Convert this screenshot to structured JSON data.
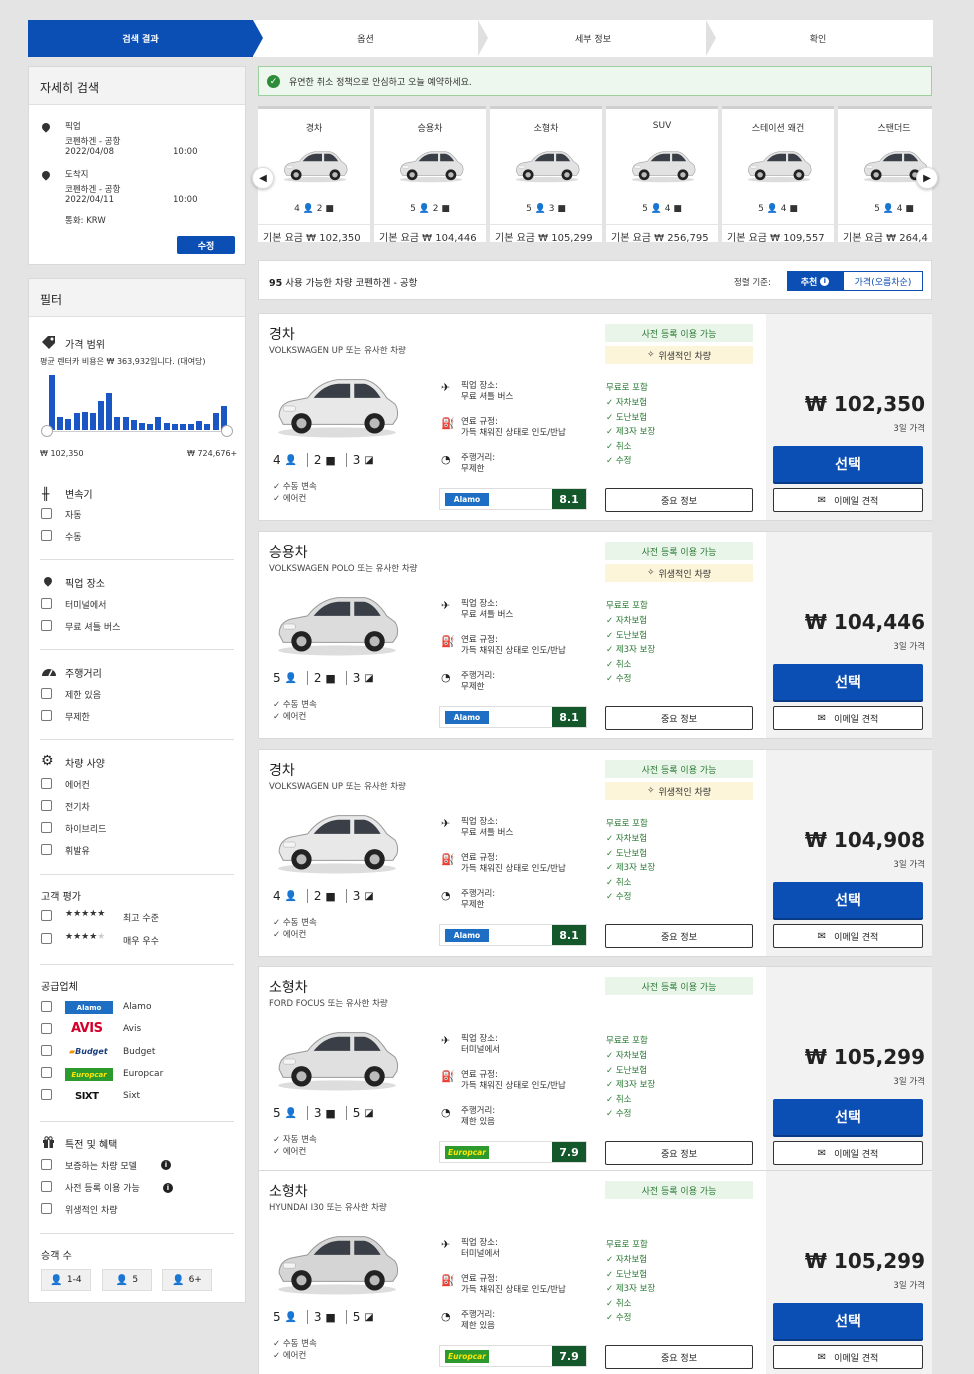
{
  "steps": [
    "검색 결과",
    "옵션",
    "세부 정보",
    "확인"
  ],
  "search": {
    "title": "자세히 검색",
    "pickup_label": "픽업",
    "pickup_location": "코펜하겐 - 공항",
    "pickup_date": "2022/04/08",
    "pickup_time": "10:00",
    "dropoff_label": "도착지",
    "dropoff_location": "코펜하겐 - 공항",
    "dropoff_date": "2022/04/11",
    "dropoff_time": "10:00",
    "currency": "통화: KRW",
    "modify_label": "수정"
  },
  "filters": {
    "title": "필터",
    "price_title": "가격 범위",
    "price_avg": "평균 렌터카 비용은 ₩ 363,932입니다. (대여당)",
    "price_min": "₩ 102,350",
    "price_max": "₩ 724,676+",
    "histogram": [
      60,
      14,
      12,
      18,
      20,
      18,
      32,
      40,
      14,
      14,
      11,
      8,
      7,
      14,
      8,
      7,
      6,
      6,
      10,
      6,
      18,
      26
    ],
    "transmission_title": "변속기",
    "transmission": [
      "자동",
      "수동"
    ],
    "pickup_title": "픽업 장소",
    "pickup_opts": [
      "터미널에서",
      "무료 셔틀 버스"
    ],
    "mileage_title": "주행거리",
    "mileage_opts": [
      "제한 있음",
      "무제한"
    ],
    "spec_title": "차량 사양",
    "spec_opts": [
      "에어컨",
      "전기차",
      "하이브리드",
      "휘발유"
    ],
    "rating_title": "고객 평가",
    "rating_opts": [
      "최고 수준",
      "매우 우수"
    ],
    "supplier_title": "공급업체",
    "suppliers": [
      "Alamo",
      "Avis",
      "Budget",
      "Europcar",
      "Sixt"
    ],
    "perks_title": "특전 및 혜택",
    "perks": [
      "보증하는 차량 모델",
      "사전 등록 이용 가능",
      "위생적인 차량"
    ],
    "pax_title": "승객 수",
    "pax": [
      "1-4",
      "5",
      "6+"
    ]
  },
  "banner": "유연한 취소 정책으로 안심하고 오늘 예약하세요.",
  "carousel": [
    {
      "name": "경차",
      "pax": "4",
      "bags": "2",
      "price": "기본 요금 ₩ 102,350"
    },
    {
      "name": "승용차",
      "pax": "5",
      "bags": "2",
      "price": "기본 요금 ₩ 104,446"
    },
    {
      "name": "소형차",
      "pax": "5",
      "bags": "3",
      "price": "기본 요금 ₩ 105,299"
    },
    {
      "name": "SUV",
      "pax": "5",
      "bags": "4",
      "price": "기본 요금 ₩ 256,795"
    },
    {
      "name": "스테이션 왜건",
      "pax": "5",
      "bags": "4",
      "price": "기본 요금 ₩ 109,557"
    },
    {
      "name": "스탠더드",
      "pax": "5",
      "bags": "4",
      "price": "기본 요금 ₩ 264,4"
    }
  ],
  "sortbar": {
    "count": "95",
    "text": "사용 가능한 차량 코펜하겐 - 공항",
    "sort_label": "정렬 기준:",
    "recommended": "추천",
    "price": "가격(오름차순)"
  },
  "labels": {
    "pickup": "픽업 장소:",
    "fuel": "연료 규정:",
    "fuel_val": "가득 채워진 상태로 인도/반납",
    "mileage": "주행거리:",
    "prereg": "사전 등록 이용 가능",
    "hygiene": "위생적인 차량",
    "included": "무료로 포함",
    "incl_items": [
      "자차보험",
      "도난보험",
      "제3자 보장",
      "취소",
      "수정"
    ],
    "important": "중요 정보",
    "per_days": "3일 가격",
    "select": "선택",
    "email": "이메일 견적"
  },
  "results": [
    {
      "title": "경차",
      "sub": "VOLKSWAGEN UP 또는 유사한 차량",
      "pax": "4",
      "bags": "2",
      "doors": "3",
      "trans": "수동 변속",
      "ac": "에어컨",
      "pickup": "무료 셔틀 버스",
      "mileage": "무제한",
      "vendor": "Alamo",
      "score": "8.1",
      "price": "₩ 102,350",
      "hygiene": true,
      "color": "#e8e8e8"
    },
    {
      "title": "승용차",
      "sub": "VOLKSWAGEN POLO 또는 유사한 차량",
      "pax": "5",
      "bags": "2",
      "doors": "3",
      "trans": "수동 변속",
      "ac": "에어컨",
      "pickup": "무료 셔틀 버스",
      "mileage": "무제한",
      "vendor": "Alamo",
      "score": "8.1",
      "price": "₩ 104,446",
      "hygiene": true,
      "color": "#dcdcdc"
    },
    {
      "title": "경차",
      "sub": "VOLKSWAGEN UP 또는 유사한 차량",
      "pax": "4",
      "bags": "2",
      "doors": "3",
      "trans": "수동 변속",
      "ac": "에어컨",
      "pickup": "무료 셔틀 버스",
      "mileage": "무제한",
      "vendor": "Alamo",
      "score": "8.1",
      "price": "₩ 104,908",
      "hygiene": true,
      "color": "#e8e8e8"
    },
    {
      "title": "소형차",
      "sub": "FORD FOCUS 또는 유사한 차량",
      "pax": "5",
      "bags": "3",
      "doors": "5",
      "trans": "자동 변속",
      "ac": "에어컨",
      "pickup": "터미널에서",
      "mileage": "제한 있음",
      "vendor": "Europcar",
      "score": "7.9",
      "price": "₩ 105,299",
      "hygiene": false,
      "color": "#e0e0e0"
    },
    {
      "title": "소형차",
      "sub": "HYUNDAI I30 또는 유사한 차량",
      "pax": "5",
      "bags": "3",
      "doors": "5",
      "trans": "수동 변속",
      "ac": "에어컨",
      "pickup": "터미널에서",
      "mileage": "제한 있음",
      "vendor": "Europcar",
      "score": "7.9",
      "price": "₩ 105,299",
      "hygiene": false,
      "color": "#d5d5d5"
    }
  ],
  "colors": {
    "brand": "#0b4fb4",
    "score": "#14572b",
    "alamo": "#1e6fc4",
    "europcar": "#2d9a2d",
    "avis": "#d4002a"
  },
  "icons": [
    "map-pin-icon",
    "plane-icon",
    "fuel-icon",
    "speedometer-icon",
    "person-icon",
    "bag-icon",
    "door-icon",
    "check-icon",
    "gear-icon",
    "gift-icon",
    "price-tag-icon",
    "transmission-icon",
    "envelope-icon",
    "info-icon",
    "sparkle-icon",
    "chevron-left-icon",
    "chevron-right-icon"
  ]
}
